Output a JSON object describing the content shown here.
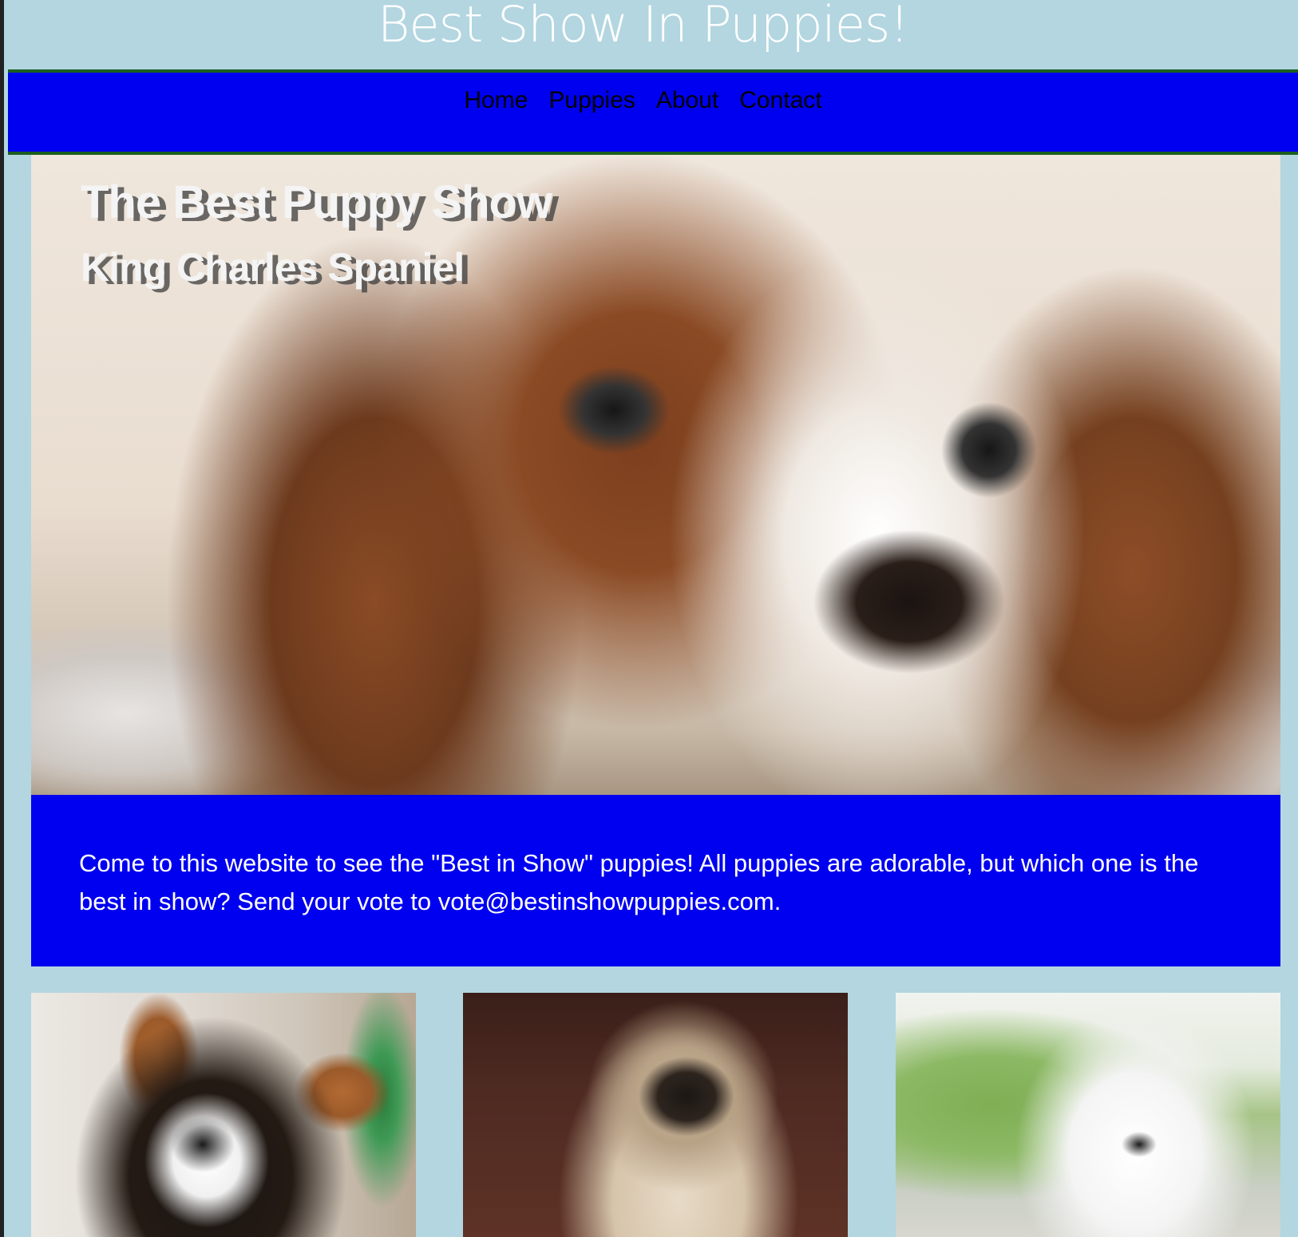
{
  "header": {
    "site_title": "Best Show In Puppies!"
  },
  "nav": {
    "items": [
      {
        "label": "Home"
      },
      {
        "label": "Puppies"
      },
      {
        "label": "About"
      },
      {
        "label": "Contact"
      }
    ]
  },
  "hero": {
    "heading": "The Best Puppy Show",
    "subheading": "King Charles Spaniel"
  },
  "intro": {
    "text": "Come to this website to see the \"Best in Show\" puppies! All puppies are adorable, but which one is the best in show? Send your vote to vote@bestinshowpuppies.com."
  },
  "colors": {
    "page_background": "#b3d6e0",
    "nav_background": "#0000f0",
    "nav_border": "#1b5e20",
    "intro_background": "#0000f0",
    "title_text": "#ffffff"
  }
}
